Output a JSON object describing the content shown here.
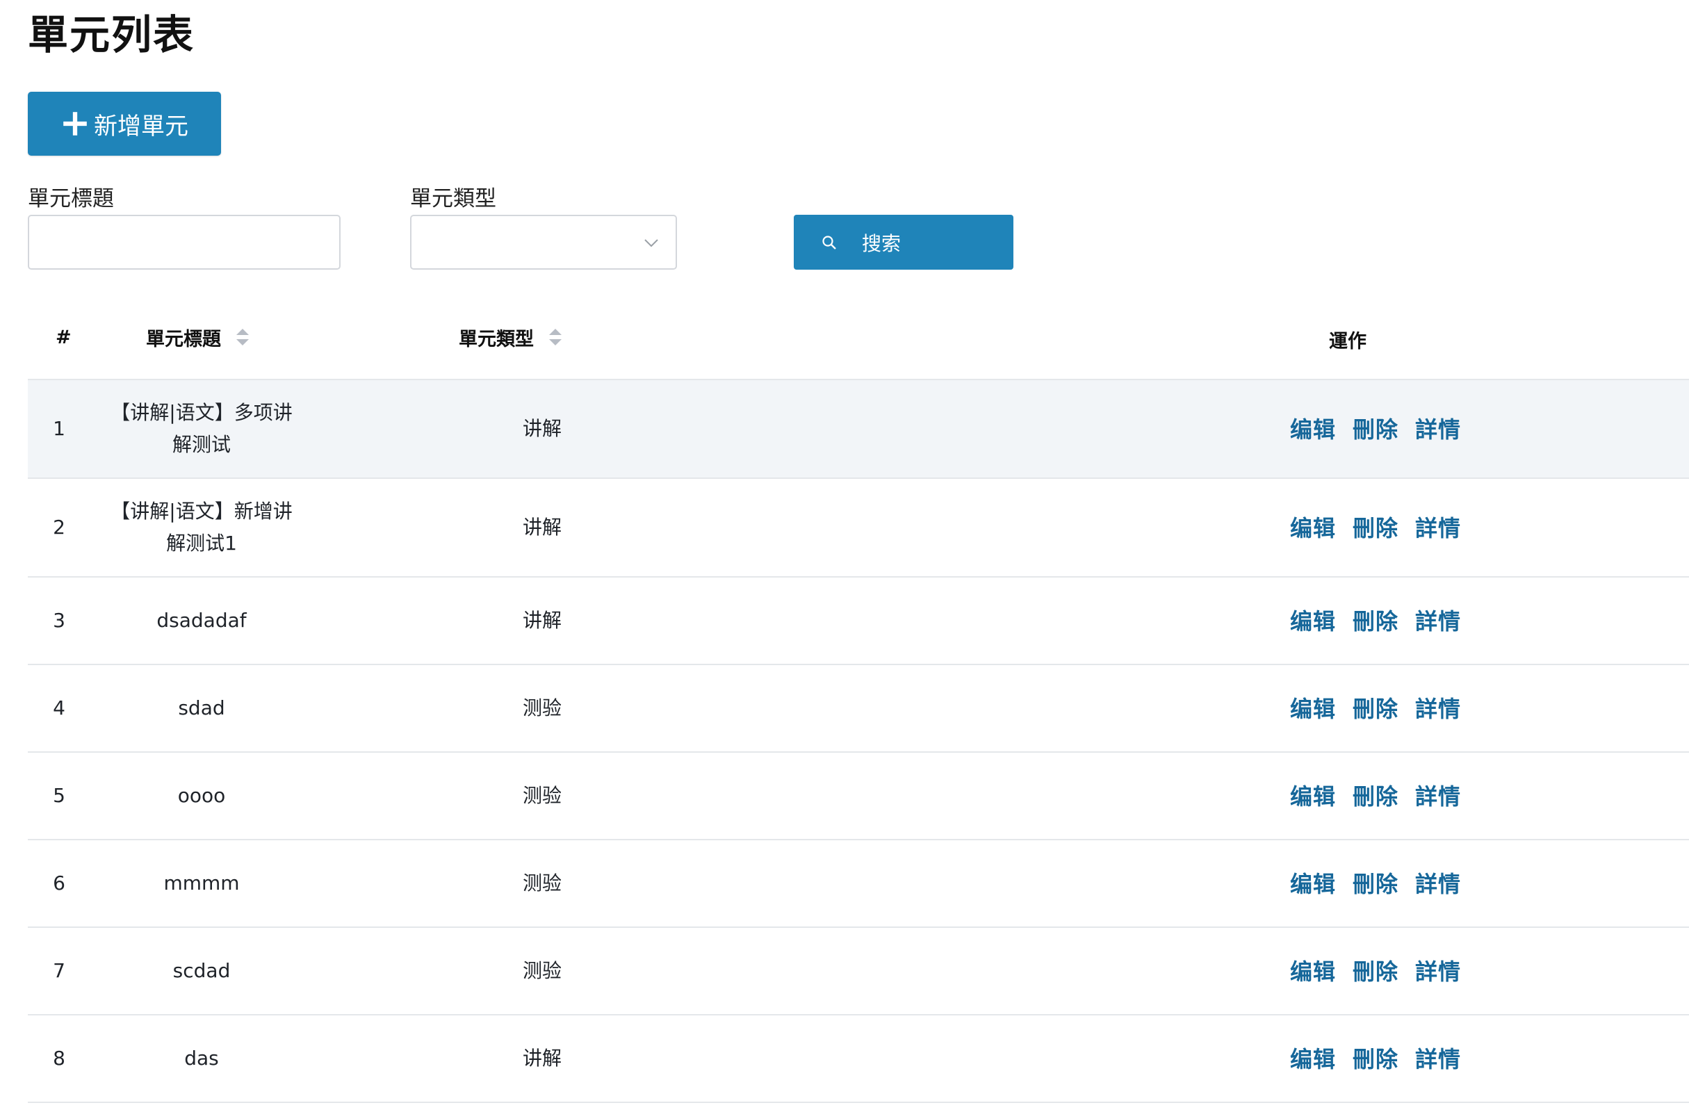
{
  "page": {
    "title": "單元列表"
  },
  "toolbar": {
    "add_label": "新增單元"
  },
  "filters": {
    "title_label": "單元標題",
    "title_value": "",
    "type_label": "單元類型",
    "type_value": "",
    "search_label": "搜索"
  },
  "table": {
    "headers": {
      "index": "#",
      "title": "單元標題",
      "type": "單元類型",
      "actions": "運作"
    },
    "actions": {
      "edit": "编辑",
      "delete": "刪除",
      "details": "詳情"
    },
    "rows": [
      {
        "index": "1",
        "title_line1": "【讲解|语文】多项讲",
        "title_line2": "解测试",
        "type": "讲解"
      },
      {
        "index": "2",
        "title_line1": "【讲解|语文】新增讲",
        "title_line2": "解测试1",
        "type": "讲解"
      },
      {
        "index": "3",
        "title_line1": "dsadadaf",
        "title_line2": "",
        "type": "讲解"
      },
      {
        "index": "4",
        "title_line1": "sdad",
        "title_line2": "",
        "type": "测验"
      },
      {
        "index": "5",
        "title_line1": "oooo",
        "title_line2": "",
        "type": "测验"
      },
      {
        "index": "6",
        "title_line1": "mmmm",
        "title_line2": "",
        "type": "测验"
      },
      {
        "index": "7",
        "title_line1": "scdad",
        "title_line2": "",
        "type": "测验"
      },
      {
        "index": "8",
        "title_line1": "das",
        "title_line2": "",
        "type": "讲解"
      }
    ]
  },
  "colors": {
    "primary": "#1f84b9",
    "link": "#16679a",
    "stripe": "#f2f5f8"
  }
}
